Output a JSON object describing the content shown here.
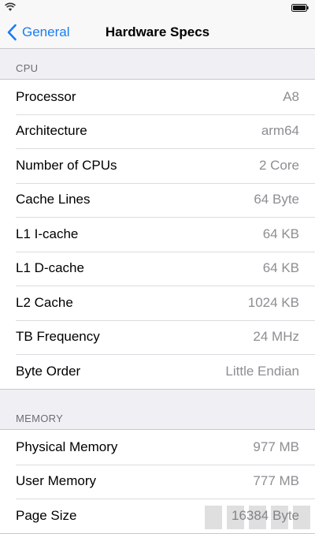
{
  "nav": {
    "back_label": "General",
    "title": "Hardware Specs"
  },
  "sections": {
    "cpu": {
      "header": "CPU",
      "rows": [
        {
          "label": "Processor",
          "value": "A8"
        },
        {
          "label": "Architecture",
          "value": "arm64"
        },
        {
          "label": "Number of CPUs",
          "value": "2 Core"
        },
        {
          "label": "Cache Lines",
          "value": "64 Byte"
        },
        {
          "label": "L1 I-cache",
          "value": "64 KB"
        },
        {
          "label": "L1 D-cache",
          "value": "64 KB"
        },
        {
          "label": "L2 Cache",
          "value": "1024 KB"
        },
        {
          "label": "TB Frequency",
          "value": "24 MHz"
        },
        {
          "label": "Byte Order",
          "value": "Little Endian"
        }
      ]
    },
    "memory": {
      "header": "MEMORY",
      "rows": [
        {
          "label": "Physical Memory",
          "value": "977 MB"
        },
        {
          "label": "User Memory",
          "value": "777 MB"
        },
        {
          "label": "Page Size",
          "value": "16384 Byte"
        }
      ]
    }
  },
  "colors": {
    "accent": "#1a7cf5",
    "background": "#efeff4",
    "value_text": "#8e8e93"
  },
  "icons": {
    "status_left": "wifi-icon",
    "status_right": "battery-icon",
    "back": "chevron-left-icon"
  }
}
